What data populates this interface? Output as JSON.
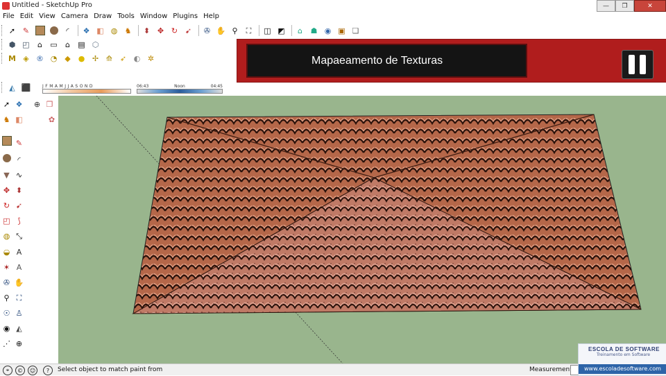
{
  "window": {
    "title": "Untitled - SketchUp Pro",
    "minimize_glyph": "—",
    "maximize_glyph": "❐",
    "close_glyph": "✕"
  },
  "menu": [
    "File",
    "Edit",
    "View",
    "Camera",
    "Draw",
    "Tools",
    "Window",
    "Plugins",
    "Help"
  ],
  "shadow_settings": {
    "months": "J F M A M J J A S O N D",
    "time_start": "06:43",
    "time_mid": "Noon",
    "time_end": "04:45"
  },
  "overlay": {
    "caption": "Mapaeamento de Texturas"
  },
  "statusbar": {
    "text": "Select object to match paint from",
    "measurements_label": "Measurements"
  },
  "watermark": {
    "line1": "ESCOLA DE SOFTWARE",
    "line2": "Treinamento em Software",
    "url": "www.escoladesoftware.com"
  },
  "colors": {
    "viewport_background": "#99b58d",
    "roof_tile": "#b86a4c",
    "overlay_red": "#b01d1d"
  }
}
